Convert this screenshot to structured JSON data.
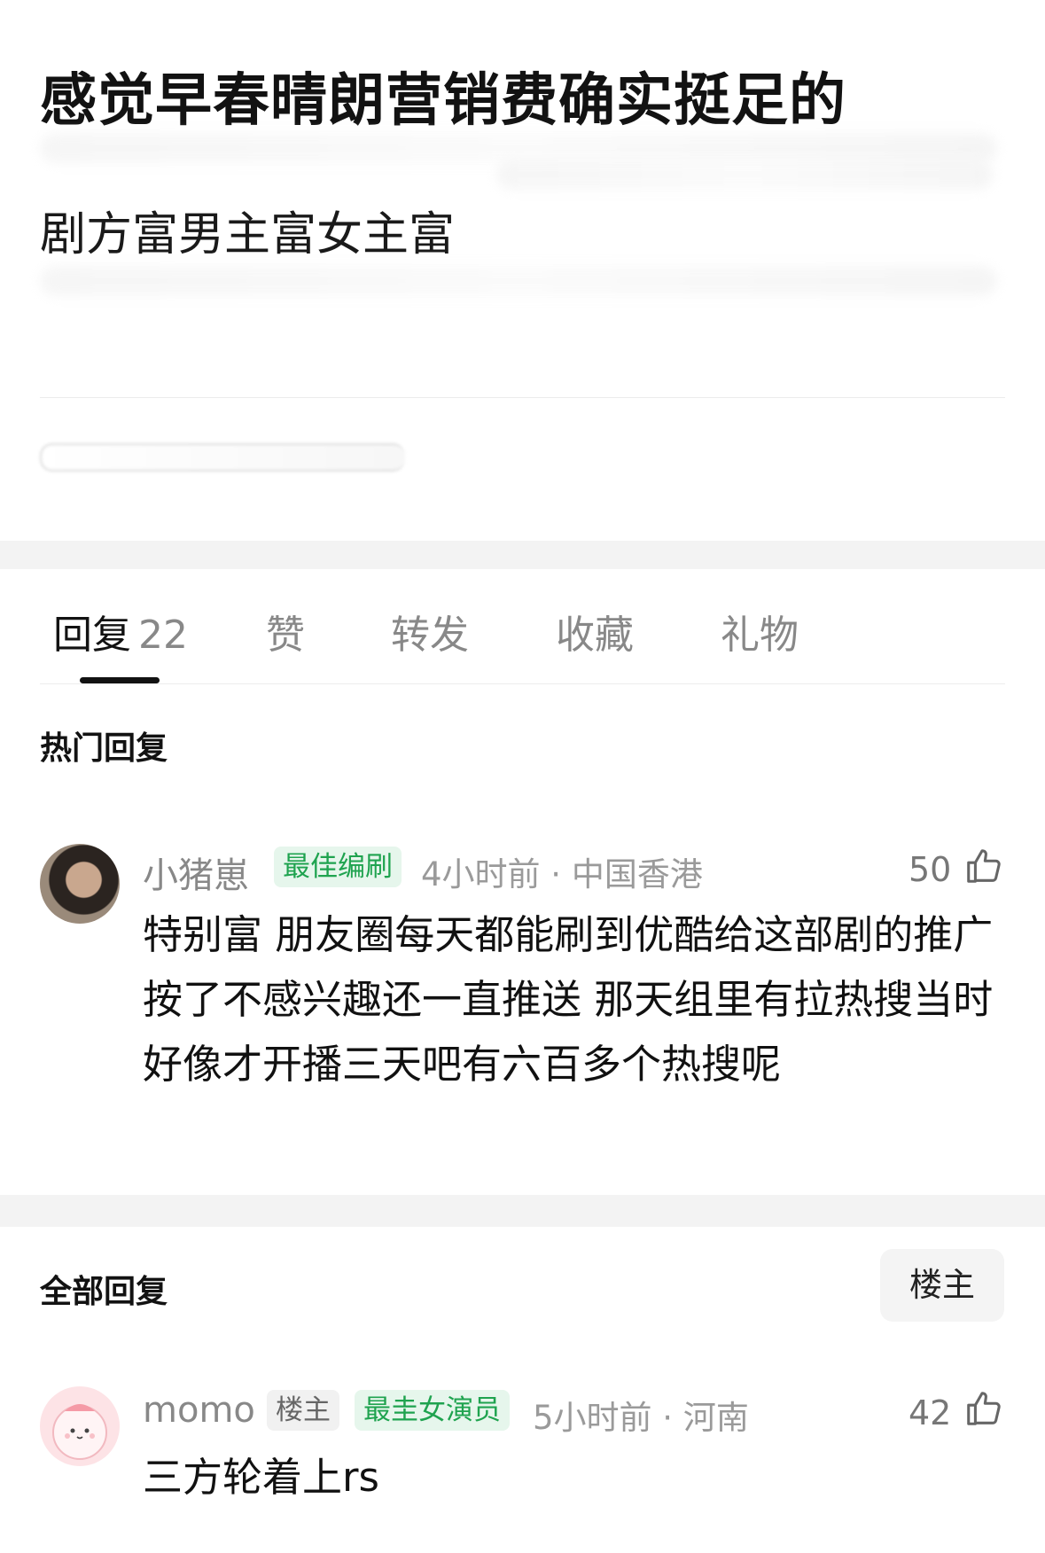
{
  "post": {
    "title": "感觉早春晴朗营销费确实挺足的",
    "body": "剧方富男主富女主富"
  },
  "tabs": {
    "reply_label": "回复",
    "reply_count": "22",
    "like_label": "赞",
    "share_label": "转发",
    "favorite_label": "收藏",
    "gift_label": "礼物"
  },
  "hot_replies": {
    "section_title": "热门回复",
    "items": [
      {
        "username": "小猪崽",
        "badges": [
          "最佳编刷"
        ],
        "time_location": "4小时前 · 中国香港",
        "likes": "50",
        "content": "特别富 朋友圈每天都能刷到优酷给这部剧的推广 按了不感兴趣还一直推送 那天组里有拉热搜当时好像才开播三天吧有六百多个热搜呢"
      }
    ]
  },
  "all_replies": {
    "section_title": "全部回复",
    "filter_button": "楼主",
    "items": [
      {
        "username": "momo",
        "op_badge": "楼主",
        "badges": [
          "最圭女演员"
        ],
        "time_location": "5小时前 · 河南",
        "likes": "42",
        "content": "三方轮着上rs"
      }
    ]
  },
  "colors": {
    "badge_green_text": "#1fa34f",
    "badge_green_bg": "#e6f6ec",
    "tab_indicator": "#121212",
    "section_gap": "#f3f3f3"
  }
}
